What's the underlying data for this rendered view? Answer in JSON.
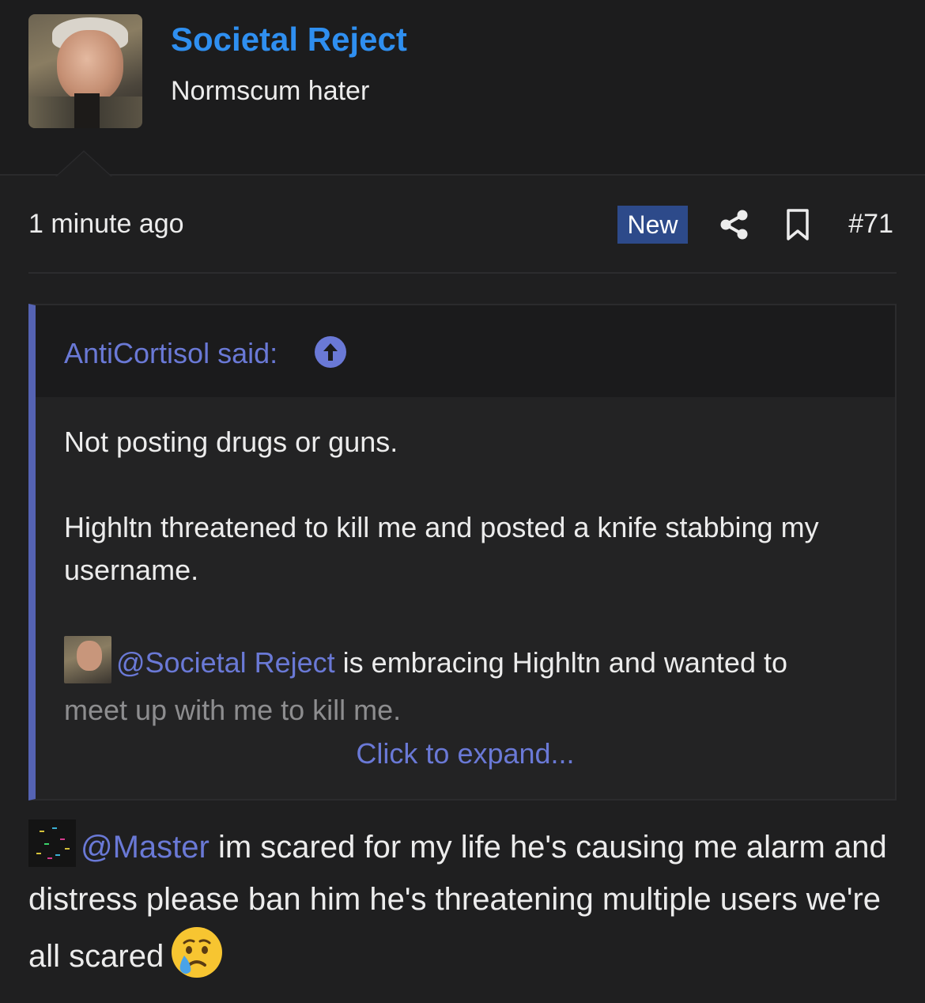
{
  "user": {
    "name": "Societal Reject",
    "title": "Normscum hater"
  },
  "meta": {
    "timestamp": "1 minute ago",
    "badge": "New",
    "post_number": "#71"
  },
  "quote": {
    "author_line": "AntiCortisol said:",
    "line1": "Not posting drugs or guns.",
    "line2": "Highltn threatened to kill me and posted a knife stabbing my username.",
    "mention": "@Societal Reject",
    "mention_rest": " is embracing Highltn and wanted to",
    "faded_line": "meet up with me to kill me.",
    "expand": "Click to expand..."
  },
  "post": {
    "mention": "@Master",
    "text": " im scared for my life he's causing me alarm and distress please ban him he's threatening multiple users we're all scared"
  },
  "icons": {
    "share": "share-icon",
    "bookmark": "bookmark-icon",
    "goto": "arrow-up-circle-icon",
    "emoji": "crying-face-emoji"
  },
  "colors": {
    "background": "#1f1f20",
    "username": "#2f8ff0",
    "link": "#6a79d6",
    "badge": "#2d4a8a",
    "quote_border": "#5563b3"
  }
}
